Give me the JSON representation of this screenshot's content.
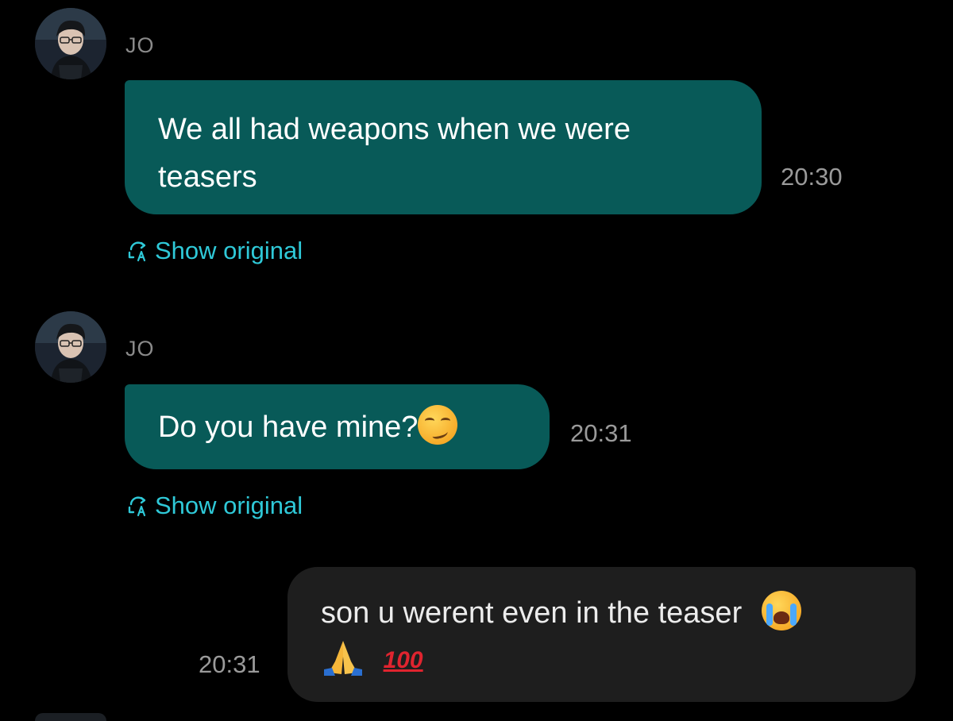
{
  "messages": [
    {
      "sender": "JO",
      "text": "We all had weapons when we were teasers",
      "time": "20:30",
      "show_original": "Show original"
    },
    {
      "sender": "JO",
      "text": "Do you have mine?",
      "emoji": "smirking-face",
      "time": "20:31",
      "show_original": "Show original"
    },
    {
      "text": "son u werent even in the teaser",
      "emojis": [
        "loudly-crying-face",
        "folded-hands",
        "hundred-points"
      ],
      "time": "20:31"
    }
  ],
  "colors": {
    "incoming_bubble": "#085a58",
    "outgoing_bubble": "#1e1e1e",
    "link_accent": "#2fc9d8",
    "timestamp": "#9a9a9a",
    "background": "#000000"
  },
  "icons": {
    "translate": "translate-icon"
  }
}
